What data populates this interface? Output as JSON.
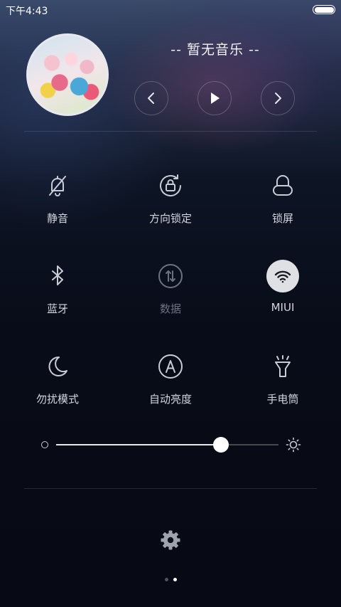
{
  "status_bar": {
    "time": "下午4:43"
  },
  "music": {
    "title": "-- 暂无音乐 --",
    "prev_icon": "chevron-left-icon",
    "play_icon": "play-icon",
    "next_icon": "chevron-right-icon"
  },
  "toggles": [
    {
      "label": "静音",
      "icon": "bell-off-icon",
      "state": "off"
    },
    {
      "label": "方向锁定",
      "icon": "rotation-lock-icon",
      "state": "off"
    },
    {
      "label": "锁屏",
      "icon": "lock-icon",
      "state": "off"
    },
    {
      "label": "蓝牙",
      "icon": "bluetooth-icon",
      "state": "off"
    },
    {
      "label": "数据",
      "icon": "mobile-data-icon",
      "state": "disabled"
    },
    {
      "label": "MIUI",
      "icon": "wifi-icon",
      "state": "on"
    },
    {
      "label": "勿扰模式",
      "icon": "moon-icon",
      "state": "off"
    },
    {
      "label": "自动亮度",
      "icon": "auto-brightness-icon",
      "state": "off"
    },
    {
      "label": "手电筒",
      "icon": "flashlight-icon",
      "state": "off"
    }
  ],
  "brightness": {
    "level": 0.74,
    "low_icon": "brightness-low-icon",
    "high_icon": "sun-icon"
  },
  "settings_icon": "gear-icon",
  "pager": {
    "pages": 2,
    "current": 2
  },
  "colors": {
    "active_toggle_bg": "#dfe0e4",
    "background_top": "#3a4a6a",
    "background_bottom": "#070a14"
  }
}
